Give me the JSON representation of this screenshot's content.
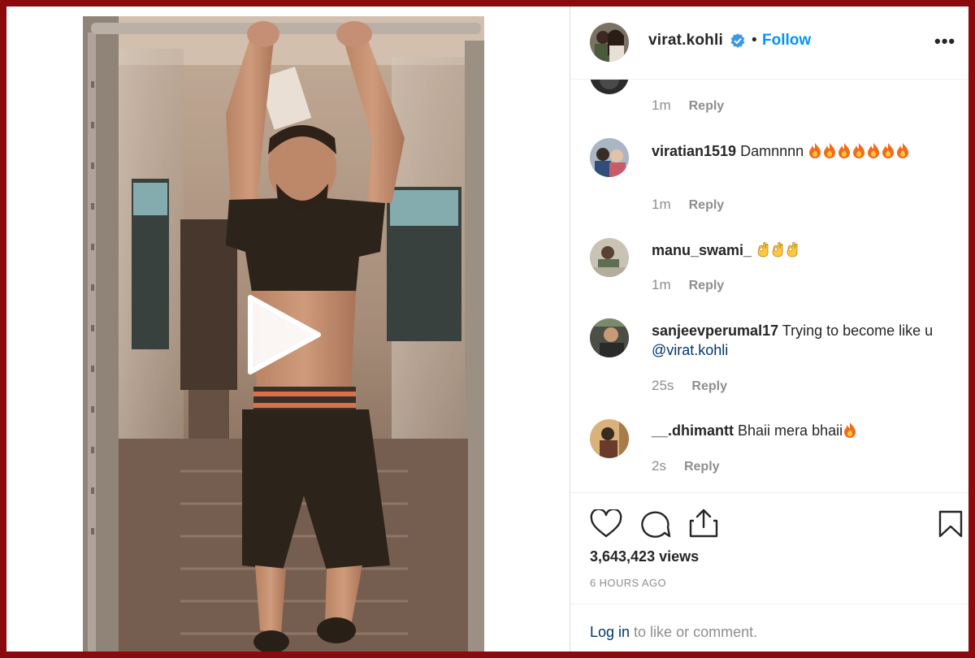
{
  "post": {
    "username": "virat.kohli",
    "separator": "•",
    "follow_label": "Follow",
    "more_label": "•••",
    "views": "3,643,423 views",
    "time_ago": "6 HOURS AGO"
  },
  "comments": [
    {
      "time": "1m",
      "reply": "Reply"
    },
    {
      "username": "viratian1519",
      "text": "Damnnnn",
      "emoji_count": 7,
      "emoji": "fire",
      "time": "1m",
      "reply": "Reply"
    },
    {
      "username": "manu_swami_",
      "text": "",
      "emoji_count": 3,
      "emoji": "ok-hand",
      "time": "1m",
      "reply": "Reply"
    },
    {
      "username": "sanjeevperumal17",
      "text": "Trying to become like u",
      "mention": "@virat.kohli",
      "time": "25s",
      "reply": "Reply"
    },
    {
      "username": "__.dhimantt",
      "text": "Bhaii mera bhaii",
      "emoji_count": 1,
      "emoji": "fire",
      "time": "2s",
      "reply": "Reply"
    }
  ],
  "footer": {
    "login_link": "Log in",
    "login_rest": " to like or comment."
  },
  "icons": {
    "like": "heart-icon",
    "comment": "comment-icon",
    "share": "share-icon",
    "save": "bookmark-icon",
    "play": "play-icon",
    "verified": "verified-badge-icon"
  },
  "colors": {
    "frame": "#8b0a0e",
    "link_blue": "#0095f6",
    "mention_blue": "#00376b",
    "muted": "#8e8e8e",
    "text": "#262626"
  }
}
